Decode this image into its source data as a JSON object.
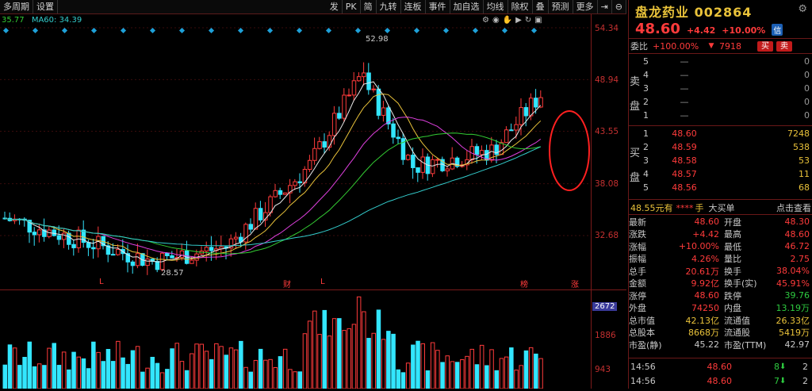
{
  "toolbar": {
    "left": [
      "多周期",
      "设置"
    ],
    "right": [
      "发",
      "PK",
      "简",
      "九转",
      "连板",
      "事件",
      "加自选",
      "均线",
      "除权",
      "叠",
      "预测",
      "更多"
    ]
  },
  "ma_legend": [
    {
      "text": "35.77",
      "color": "#33cc33"
    },
    {
      "text": "MA60: 34.39",
      "color": "#33cccc"
    }
  ],
  "y_axis": [
    "54.34",
    "48.94",
    "43.55",
    "38.08",
    "32.68"
  ],
  "vol_axis": [
    "1886",
    "943"
  ],
  "vol_current": "2672",
  "annotations": {
    "high": "52.98",
    "low": "28.57",
    "markers": [
      "L",
      "财",
      "L",
      "榜",
      "涨"
    ]
  },
  "stock": {
    "name": "盘龙药业",
    "code": "002864",
    "price": "48.60",
    "change": "+4.42",
    "pct": "+10.00%",
    "xin": "信"
  },
  "weibi": {
    "label": "委比",
    "value": "+100.00%",
    "num": "7918",
    "buy_btn": "买",
    "sell_btn": "卖"
  },
  "sell_book": [
    {
      "lv": "5",
      "px": "—",
      "vol": "0"
    },
    {
      "lv": "4",
      "px": "—",
      "vol": "0"
    },
    {
      "lv": "3",
      "px": "—",
      "vol": "0"
    },
    {
      "lv": "2",
      "px": "—",
      "vol": "0"
    },
    {
      "lv": "1",
      "px": "—",
      "vol": "0"
    }
  ],
  "buy_book": [
    {
      "lv": "1",
      "px": "48.60",
      "vol": "7248"
    },
    {
      "lv": "2",
      "px": "48.59",
      "vol": "538"
    },
    {
      "lv": "3",
      "px": "48.58",
      "vol": "53"
    },
    {
      "lv": "4",
      "px": "48.57",
      "vol": "11"
    },
    {
      "lv": "5",
      "px": "48.56",
      "vol": "68"
    }
  ],
  "side_labels": {
    "sell": [
      "卖",
      "盘"
    ],
    "buy": [
      "买",
      "盘"
    ]
  },
  "big_order": {
    "price": "48.55",
    "unit": "元有",
    "hidden": "****",
    "hand": "手",
    "label": "大买单",
    "link": "点击查看"
  },
  "stats": [
    {
      "k1": "最新",
      "v1": "48.60",
      "k2": "开盘",
      "v2": "48.30"
    },
    {
      "k1": "涨跌",
      "v1": "+4.42",
      "k2": "最高",
      "v2": "48.60"
    },
    {
      "k1": "涨幅",
      "v1": "+10.00%",
      "k2": "最低",
      "v2": "46.72"
    },
    {
      "k1": "振幅",
      "v1": "4.26%",
      "k2": "量比",
      "v2": "2.75"
    },
    {
      "k1": "总手",
      "v1": "20.61万",
      "k2": "换手",
      "v2": "38.04%"
    },
    {
      "k1": "金额",
      "v1": "9.92亿",
      "k2": "换手(实)",
      "v2": "45.91%"
    },
    {
      "k1": "涨停",
      "v1": "48.60",
      "k2": "跌停",
      "v2": "39.76"
    },
    {
      "k1": "外盘",
      "v1": "74250",
      "k2": "内盘",
      "v2": "13.19万"
    },
    {
      "k1": "总市值",
      "v1": "42.13亿",
      "k2": "流通值",
      "v2": "26.33亿"
    },
    {
      "k1": "总股本",
      "v1": "8668万",
      "k2": "流通股",
      "v2": "5419万"
    },
    {
      "k1": "市盈(静)",
      "v1": "45.22",
      "k2": "市盈(TTM)",
      "v2": "42.97"
    }
  ],
  "ticks": [
    {
      "t": "14:56",
      "p": "48.60",
      "q": "8",
      "n": "2"
    },
    {
      "t": "14:56",
      "p": "48.60",
      "q": "7",
      "n": "2"
    }
  ]
}
